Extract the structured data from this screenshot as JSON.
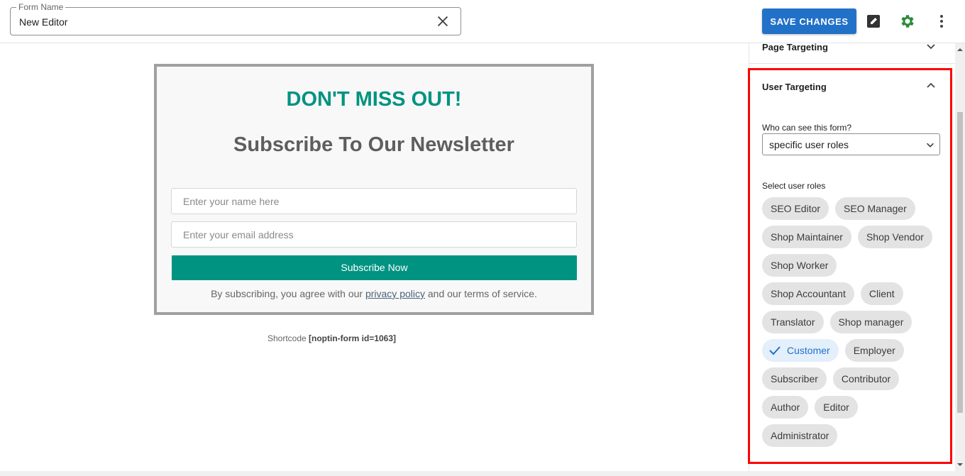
{
  "header": {
    "form_name_label": "Form Name",
    "form_name_value": "New Editor",
    "save_label": "SAVE CHANGES",
    "accent_color": "#2271c8",
    "settings_icon_color": "#2e8b3a"
  },
  "form_preview": {
    "heading": "DON'T MISS OUT!",
    "subheading": "Subscribe To Our Newsletter",
    "name_placeholder": "Enter your name here",
    "email_placeholder": "Enter your email address",
    "button_label": "Subscribe Now",
    "terms_prefix": "By subscribing, you agree with our",
    "privacy_link": "privacy policy",
    "terms_suffix": "and our terms of service.",
    "brand_color": "#009382"
  },
  "shortcode": {
    "label": "Shortcode",
    "code": "[noptin-form id=1063]"
  },
  "sidebar": {
    "page_targeting": "Page Targeting",
    "user_targeting": "User Targeting",
    "who_label": "Who can see this form?",
    "who_value": "specific user roles",
    "roles_label": "Select user roles",
    "roles": [
      "SEO Editor",
      "SEO Manager",
      "Shop Maintainer",
      "Shop Vendor",
      "Shop Worker",
      "Shop Accountant",
      "Client",
      "Translator",
      "Shop manager",
      "Customer",
      "Employer",
      "Subscriber",
      "Contributor",
      "Author",
      "Editor",
      "Administrator"
    ],
    "selected_role": "Customer"
  }
}
